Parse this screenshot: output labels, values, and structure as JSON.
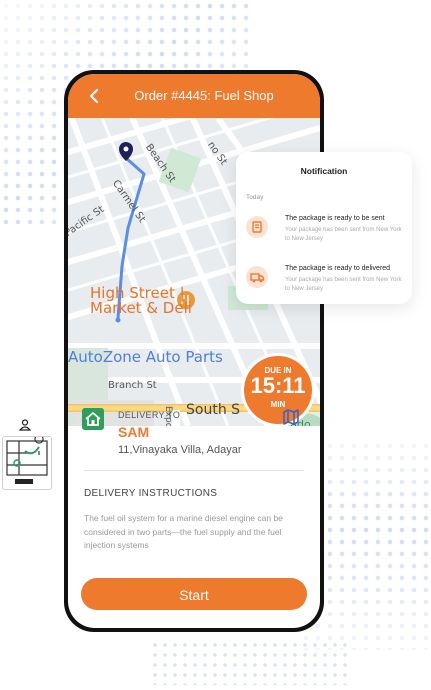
{
  "app": {
    "title": "Order #4445: Fuel Shop"
  },
  "map": {
    "labels": {
      "beach": "Beach St",
      "st_fragment": "no St",
      "carmel": "Carmel St",
      "pacific": "Pacific St",
      "high_street_line1": "High Street |",
      "high_street_line2": "Market & Deli",
      "autozone": "AutoZone Auto Parts",
      "branch": "Branch St",
      "south": "South S",
      "exposition": "Exposi",
      "meadow": "Meado"
    },
    "route_color": "#5b8de6",
    "pin_color": "#1f1f5c"
  },
  "due": {
    "top": "DUE IN",
    "time": "15:11",
    "unit": "MIN"
  },
  "delivery": {
    "label": "DELIVERY TO",
    "name": "SAM",
    "address": "11,Vinayaka Villa, Adayar"
  },
  "instructions": {
    "heading": "DELIVERY INSTRUCTIONS",
    "body": "The fuel oil system for a marine diesel engine can be considered in two parts—the fuel supply and the fuel injection systems"
  },
  "start_button": {
    "label": "Start"
  },
  "notification": {
    "header": "Notification",
    "section": "Today",
    "items": [
      {
        "title": "The package is ready to be sent",
        "desc": "Your package has been sent from New York to New Jersey",
        "icon": "package-icon"
      },
      {
        "title": "The package is ready to delivered",
        "desc": "Your package has been sent from New York to New Jersey",
        "icon": "truck-icon"
      }
    ]
  },
  "colors": {
    "accent": "#ee7a2e",
    "green": "#2f9e5a",
    "accent_soft": "#fbe2d2"
  }
}
